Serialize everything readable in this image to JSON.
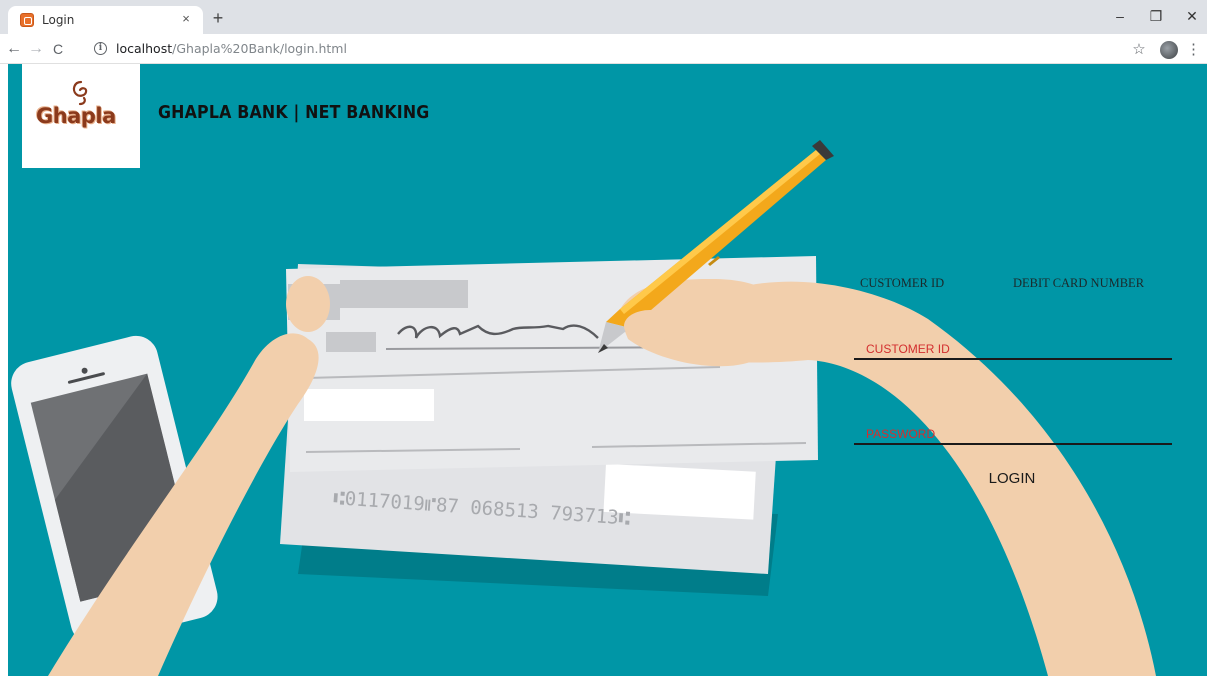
{
  "browser": {
    "tab_title": "Login",
    "tab_close": "×",
    "new_tab": "+",
    "url_host": "localhost",
    "url_path": "/Ghapla%20Bank/login.html",
    "window_controls": {
      "minimize": "–",
      "maximize": "❐",
      "close": "✕"
    },
    "nav": {
      "back": "←",
      "forward": "→",
      "reload": "C"
    },
    "star": "☆",
    "menu": "⋮",
    "info": "i"
  },
  "header": {
    "logo_text": "Ghapla",
    "title": "GHAPLA BANK | NET BANKING"
  },
  "login": {
    "tabs": [
      "CUSTOMER ID",
      "DEBIT CARD NUMBER"
    ],
    "customer_id_placeholder": "CUSTOMER ID",
    "password_placeholder": "PASSWORD",
    "login_label": "LOGIN"
  },
  "cheque": {
    "micr_line": "⑆0117019⑈87 068513 793713⑆"
  },
  "colors": {
    "page_bg": "#0096a6",
    "accent_text": "#d32f2f",
    "skin": "#f2cfac"
  }
}
